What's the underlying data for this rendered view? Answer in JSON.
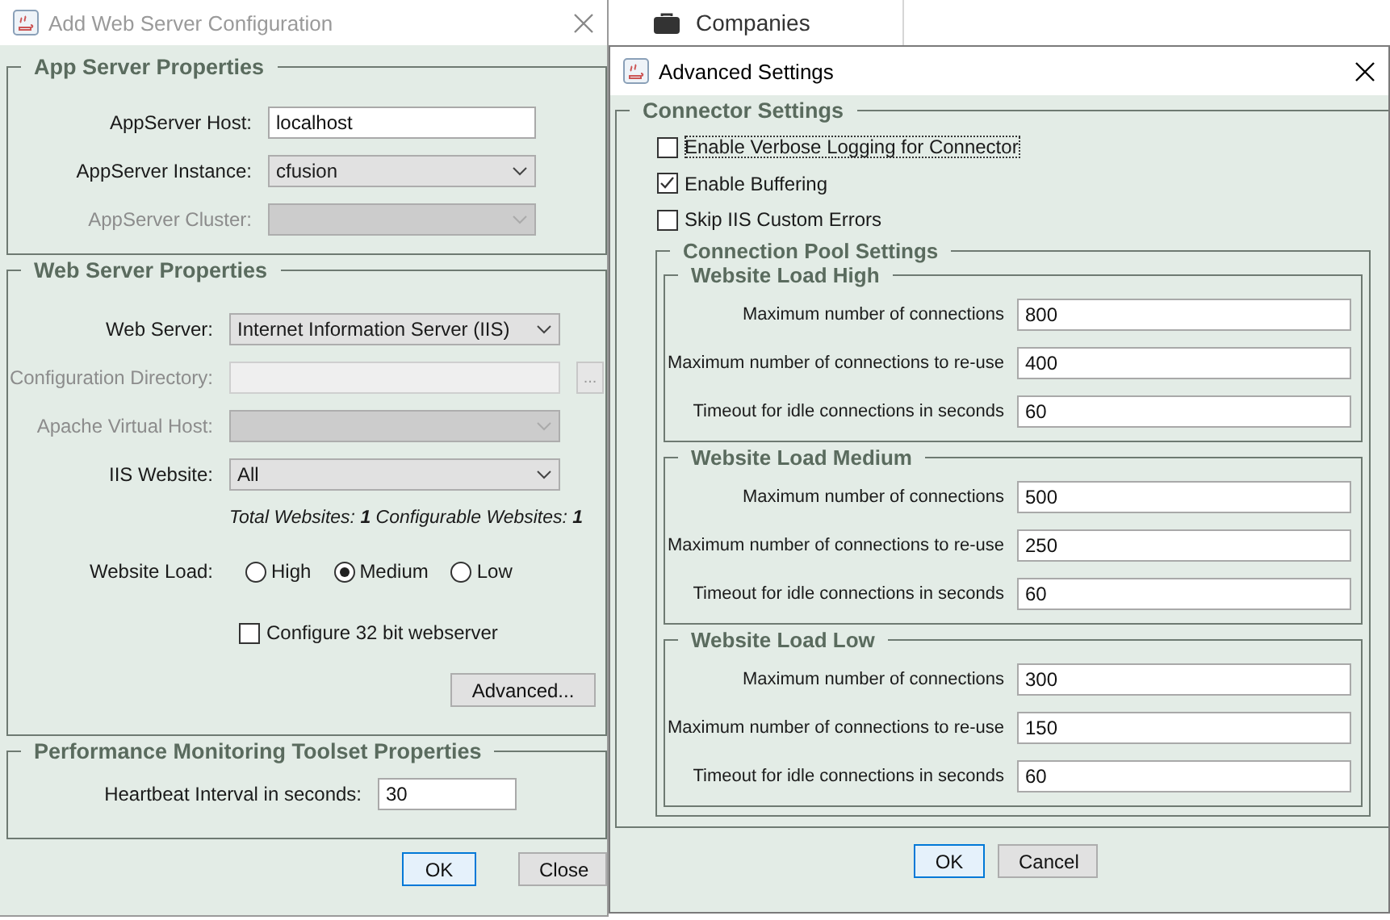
{
  "background_app": {
    "nav_item": "Companies"
  },
  "web_server_dialog": {
    "title": "Add Web Server Configuration",
    "active": false,
    "app_server": {
      "title": "App Server Properties",
      "fields": [
        {
          "label": "AppServer Host:",
          "kind": "text",
          "value": "localhost",
          "disabled": false
        },
        {
          "label": "AppServer Instance:",
          "kind": "dropdown",
          "value": "cfusion",
          "disabled": false
        },
        {
          "label": "AppServer Cluster:",
          "kind": "dropdown",
          "disabled": true
        }
      ]
    },
    "web_server": {
      "title": "Web Server Properties",
      "fields": [
        {
          "label": "Web Server:",
          "kind": "dropdown",
          "value": "Internet Information Server (IIS)",
          "disabled": false
        },
        {
          "label": "Configuration Directory:",
          "kind": "browse",
          "browse_label": "...",
          "disabled": true
        },
        {
          "label": "Apache Virtual Host:",
          "kind": "dropdown",
          "disabled": true
        },
        {
          "label": "IIS Website:",
          "kind": "dropdown",
          "value": "All",
          "disabled": false
        }
      ],
      "summary": "Total Websites: **1** Configurable Websites: **1**",
      "website_load": {
        "label": "Website Load:",
        "options": [
          {
            "label": "High",
            "selected": false
          },
          {
            "label": "Medium",
            "selected": true
          },
          {
            "label": "Low",
            "selected": false
          }
        ]
      },
      "bit32": {
        "label": "Configure 32 bit webserver",
        "checked": false
      },
      "advanced_button": "Advanced..."
    },
    "performance": {
      "title": "Performance Monitoring Toolset Properties",
      "fields": [
        {
          "label": "Heartbeat Interval in seconds:",
          "value": "30"
        }
      ]
    },
    "buttons": [
      {
        "label": "OK",
        "focused": true
      },
      {
        "label": "Close",
        "focused": false
      }
    ]
  },
  "advanced_dialog": {
    "title": "Advanced Settings",
    "active": true,
    "connector": {
      "title": "Connector Settings",
      "options": [
        {
          "label": "Enable Verbose Logging for Connector",
          "checked": false,
          "focused": true
        },
        {
          "label": "Enable Buffering",
          "checked": true,
          "focused": false
        },
        {
          "label": "Skip IIS Custom Errors",
          "checked": false,
          "focused": false
        }
      ]
    },
    "pool": {
      "title": "Connection Pool Settings",
      "groups": [
        {
          "title": "Website Load High",
          "fields": [
            {
              "label": "Maximum number of connections",
              "value": "800"
            },
            {
              "label": "Maximum number of connections to re-use",
              "value": "400"
            },
            {
              "label": "Timeout for idle connections in seconds",
              "value": "60"
            }
          ]
        },
        {
          "title": "Website Load Medium",
          "fields": [
            {
              "label": "Maximum number of connections",
              "value": "500"
            },
            {
              "label": "Maximum number of connections to re-use",
              "value": "250"
            },
            {
              "label": "Timeout for idle connections in seconds",
              "value": "60"
            }
          ]
        },
        {
          "title": "Website Load Low",
          "fields": [
            {
              "label": "Maximum number of connections",
              "value": "300"
            },
            {
              "label": "Maximum number of connections to re-use",
              "value": "150"
            },
            {
              "label": "Timeout for idle connections in seconds",
              "value": "60"
            }
          ]
        }
      ]
    },
    "buttons": [
      {
        "label": "OK",
        "focused": true
      },
      {
        "label": "Cancel",
        "focused": false
      }
    ]
  }
}
